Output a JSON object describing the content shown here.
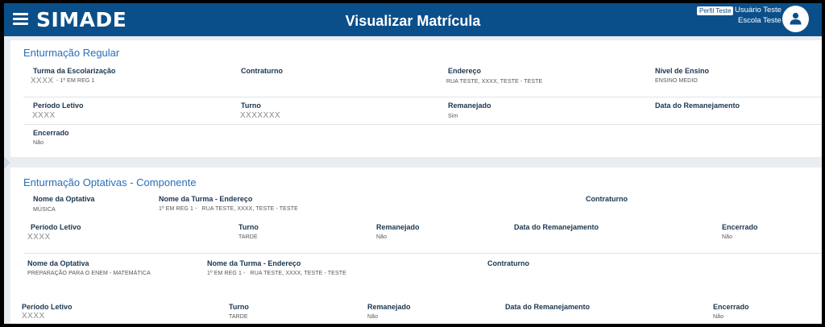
{
  "header": {
    "logo": "SIMADE",
    "title": "Visualizar Matrícula",
    "profile_badge": "Perfil Teste",
    "user_name": "Usuário Teste",
    "school_name": "Escola Teste"
  },
  "regular": {
    "title": "Enturmação Regular",
    "row1": {
      "turma_label": "Turma da Escolarização",
      "turma_value_x": "XXXX",
      "turma_value": "- 1º EM REG 1",
      "contraturno_label": "Contraturno",
      "endereco_label": "Endereço",
      "endereco_value": "RUA TESTE, XXXX, TESTE - TESTE",
      "nivel_label": "Nível de Ensino",
      "nivel_value": "ENSINO MEDIO"
    },
    "row2": {
      "periodo_label": "Período Letivo",
      "periodo_value": "XXXX",
      "turno_label": "Turno",
      "turno_value": "XXXXXXX",
      "remanejado_label": "Remanejado",
      "remanejado_value": "Sim",
      "data_label": "Data do Remanejamento"
    },
    "row3": {
      "encerrado_label": "Encerrado",
      "encerrado_value": "Não"
    }
  },
  "optativas": {
    "title": "Enturmação Optativas - Componente",
    "block1": {
      "optativa_label": "Nome da Optativa",
      "optativa_value": "MÚSICA",
      "turma_label": "Nome da Turma - Endereço",
      "turma_value": "1º EM REG 1 -   RUA TESTE, XXXX, TESTE - TESTE",
      "contraturno_label": "Contraturno",
      "periodo_label": "Período Letivo",
      "periodo_value": "XXXX",
      "turno_label": "Turno",
      "turno_value": "TARDE",
      "remanejado_label": "Remanejado",
      "remanejado_value": "Não",
      "data_label": "Data do Remanejamento",
      "encerrado_label": "Encerrado",
      "encerrado_value": "Não"
    },
    "block2": {
      "optativa_label": "Nome da Optativa",
      "optativa_value": "PREPARAÇÃO PARA O ENEM - MATEMÁTICA",
      "turma_label": "Nome da Turma - Endereço",
      "turma_value": "1º EM REG 1 -   RUA TESTE, XXXX, TESTE - TESTE",
      "contraturno_label": "Contraturno",
      "periodo_label": "Período Letivo",
      "periodo_value": "XXXX",
      "turno_label": "Turno",
      "turno_value": "TARDE",
      "remanejado_label": "Remanejado",
      "remanejado_value": "Não",
      "data_label": "Data do Remanejamento",
      "encerrado_label": "Encerrado",
      "encerrado_value": "Não"
    }
  },
  "colors": {
    "header_bg": "#0b4f8a",
    "section_title": "#2a6ebb",
    "label": "#1a3550"
  },
  "icons": {
    "menu": "hamburger-icon",
    "avatar": "user-icon"
  }
}
